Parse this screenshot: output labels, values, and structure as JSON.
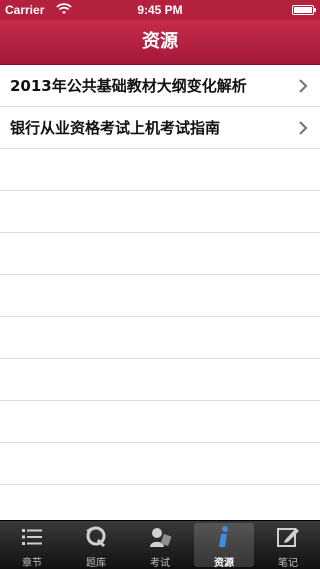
{
  "status_bar": {
    "carrier": "Carrier",
    "time": "9:45 PM",
    "icons": [
      "wifi-icon",
      "battery-icon"
    ]
  },
  "nav": {
    "title": "资源"
  },
  "list": {
    "items": [
      {
        "label": "2013年公共基础教材大纲变化解析"
      },
      {
        "label": "银行从业资格考试上机考试指南"
      }
    ]
  },
  "tab_bar": {
    "tabs": [
      {
        "label": "章节",
        "icon": "list-icon"
      },
      {
        "label": "题库",
        "icon": "question-bank-icon"
      },
      {
        "label": "考试",
        "icon": "exam-icon"
      },
      {
        "label": "资源",
        "icon": "info-icon",
        "active": true
      },
      {
        "label": "笔记",
        "icon": "note-edit-icon"
      }
    ]
  },
  "colors": {
    "nav_bar": "#b4213f",
    "tab_bar": "#1c1c1c",
    "accent_active": "#2a7bd6"
  }
}
